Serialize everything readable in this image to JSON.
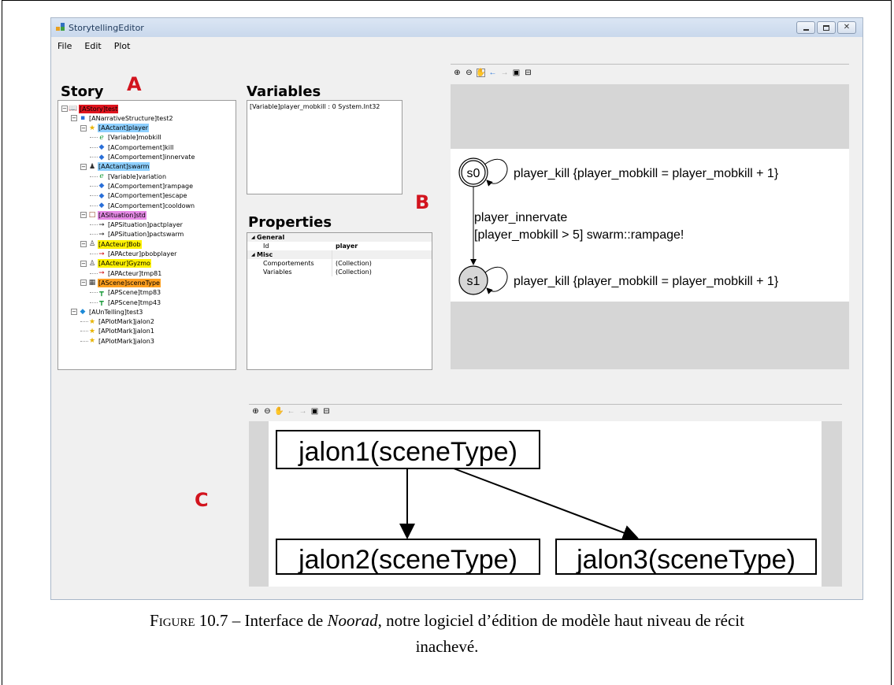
{
  "window": {
    "title": "StorytellingEditor",
    "menu": [
      "File",
      "Edit",
      "Plot"
    ]
  },
  "markers": {
    "a": "A",
    "b": "B",
    "c": "C"
  },
  "story": {
    "heading": "Story",
    "nodes": [
      {
        "label": "[AStory]test",
        "level": 0,
        "icon": "story-icon",
        "highlight": "red"
      },
      {
        "label": "[ANarrativeStructure]test2",
        "level": 1,
        "icon": "structure-icon",
        "highlight": ""
      },
      {
        "label": "[AActant]player",
        "level": 2,
        "icon": "star-icon",
        "highlight": "blue"
      },
      {
        "label": "[Variable]mobkill",
        "level": 3,
        "icon": "variable-icon",
        "highlight": ""
      },
      {
        "label": "[AComportement]kill",
        "level": 3,
        "icon": "behaviour-icon",
        "highlight": ""
      },
      {
        "label": "[AComportement]innervate",
        "level": 3,
        "icon": "behaviour-icon",
        "highlight": ""
      },
      {
        "label": "[AActant]swarm",
        "level": 2,
        "icon": "figure-icon",
        "highlight": "blue"
      },
      {
        "label": "[Variable]variation",
        "level": 3,
        "icon": "variable-icon",
        "highlight": ""
      },
      {
        "label": "[AComportement]rampage",
        "level": 3,
        "icon": "behaviour-icon",
        "highlight": ""
      },
      {
        "label": "[AComportement]escape",
        "level": 3,
        "icon": "behaviour-icon",
        "highlight": ""
      },
      {
        "label": "[AComportement]cooldown",
        "level": 3,
        "icon": "behaviour-icon",
        "highlight": ""
      },
      {
        "label": "[ASituation]std",
        "level": 2,
        "icon": "situation-icon",
        "highlight": "pink"
      },
      {
        "label": "[APSituation]pactplayer",
        "level": 3,
        "icon": "arrow-icon",
        "highlight": ""
      },
      {
        "label": "[APSituation]pactswarm",
        "level": 3,
        "icon": "arrow-icon",
        "highlight": ""
      },
      {
        "label": "[AActeur]Bob",
        "level": 2,
        "icon": "person-icon",
        "highlight": "yellow"
      },
      {
        "label": "[APActeur]pbobplayer",
        "level": 3,
        "icon": "red-arrow-icon",
        "highlight": ""
      },
      {
        "label": "[AActeur]Gyzmo",
        "level": 2,
        "icon": "person-icon",
        "highlight": "yellow"
      },
      {
        "label": "[APActeur]tmp81",
        "level": 3,
        "icon": "red-arrow-icon",
        "highlight": ""
      },
      {
        "label": "[AScene]sceneType",
        "level": 2,
        "icon": "clapper-icon",
        "highlight": "orange"
      },
      {
        "label": "[APScene]tmp83",
        "level": 3,
        "icon": "scene-pin-icon",
        "highlight": ""
      },
      {
        "label": "[APScene]tmp43",
        "level": 3,
        "icon": "scene-pin-icon",
        "highlight": ""
      },
      {
        "label": "[AUnTelling]test3",
        "level": 1,
        "icon": "gem-icon",
        "highlight": ""
      },
      {
        "label": "[APlotMark]jalon2",
        "level": 2,
        "icon": "star-icon",
        "highlight": ""
      },
      {
        "label": "[APlotMark]jalon1",
        "level": 2,
        "icon": "star-icon",
        "highlight": ""
      },
      {
        "label": "[APlotMark]jalon3",
        "level": 2,
        "icon": "star-icon",
        "highlight": ""
      }
    ]
  },
  "variables": {
    "heading": "Variables",
    "items": [
      "[Variable]player_mobkill : 0 System.Int32"
    ]
  },
  "properties": {
    "heading": "Properties",
    "rows": [
      {
        "type": "category",
        "key": "General",
        "value": ""
      },
      {
        "type": "row",
        "key": "Id",
        "value": "player",
        "bold": true
      },
      {
        "type": "category",
        "key": "Misc",
        "value": ""
      },
      {
        "type": "row",
        "key": "Comportements",
        "value": "(Collection)",
        "bold": false
      },
      {
        "type": "row",
        "key": "Variables",
        "value": "(Collection)",
        "bold": false
      }
    ]
  },
  "toolbar": {
    "icons": [
      "zoom-in-icon",
      "zoom-out-icon",
      "pan-hand-icon",
      "back-arrow-icon",
      "forward-arrow-icon",
      "save-icon",
      "print-icon"
    ]
  },
  "state_graph": {
    "states": [
      "s0",
      "s1"
    ],
    "s0_loop": "player_kill {player_mobkill = player_mobkill + 1}",
    "transition_line1": "player_innervate",
    "transition_line2": "[player_mobkill > 5] swarm::rampage!",
    "s1_loop": "player_kill {player_mobkill = player_mobkill + 1}"
  },
  "plot_graph": {
    "nodes": [
      "jalon1(sceneType)",
      "jalon2(sceneType)",
      "jalon3(sceneType)"
    ]
  },
  "caption": {
    "label": "Figure 10.7",
    "dash": " – Interface de ",
    "name": "Noorad",
    "rest1": ", notre logiciel d’édition de modèle haut niveau de récit",
    "rest2": "inachevé."
  }
}
